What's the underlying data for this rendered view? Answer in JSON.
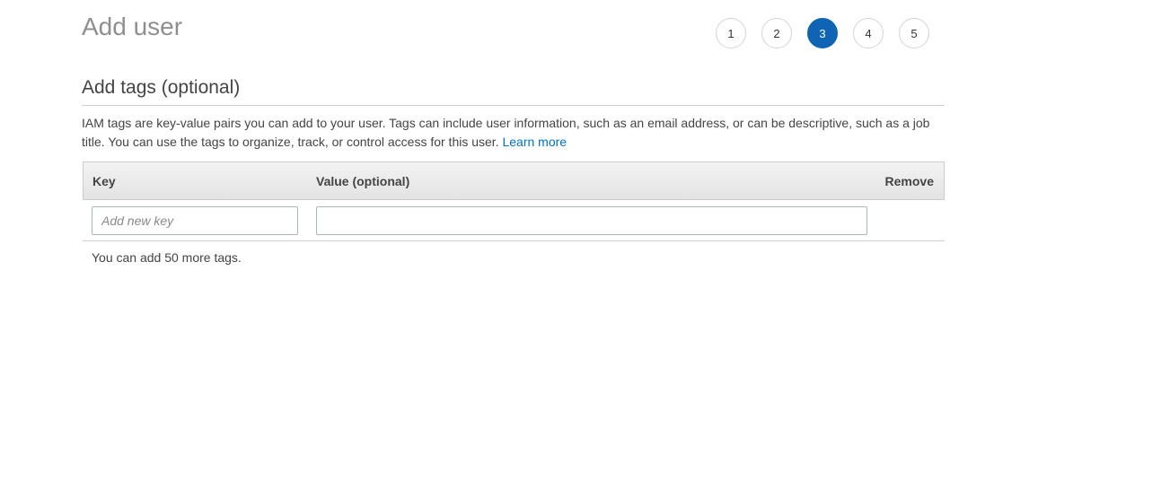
{
  "page": {
    "title": "Add user"
  },
  "steps": {
    "items": [
      "1",
      "2",
      "3",
      "4",
      "5"
    ],
    "active": "3"
  },
  "section": {
    "title": "Add tags (optional)",
    "description": "IAM tags are key-value pairs you can add to your user. Tags can include user information, such as an email address, or can be descriptive, such as a job title. You can use the tags to organize, track, or control access for this user.",
    "learn_more": "Learn more"
  },
  "table": {
    "headers": {
      "key": "Key",
      "value": "Value (optional)",
      "remove": "Remove"
    },
    "row": {
      "key_value": "",
      "key_placeholder": "Add new key",
      "value_value": ""
    }
  },
  "note": "You can add 50 more tags.",
  "colors": {
    "active_step": "#0f64b4",
    "link": "#0073bb"
  }
}
